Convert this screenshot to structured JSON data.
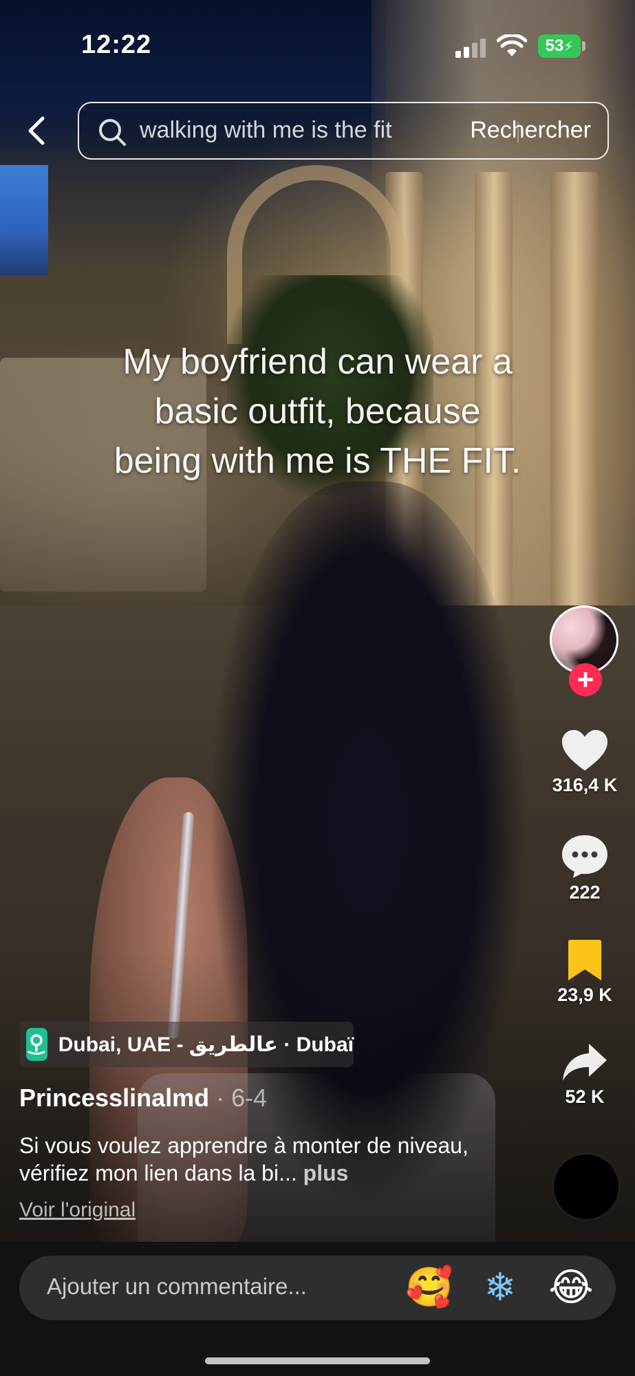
{
  "status_bar": {
    "time": "12:22",
    "battery": "53",
    "battery_color": "#35c759"
  },
  "search": {
    "query": "walking with me is the fit",
    "submit_label": "Rechercher",
    "icon": "search-icon"
  },
  "video": {
    "caption": "My boyfriend can wear a\nbasic outfit, because\nbeing with me is THE FIT."
  },
  "actions": {
    "follow_label": "+",
    "like_count": "316,4 K",
    "comment_count": "222",
    "save_count": "23,9 K",
    "share_count": "52 K",
    "save_color": "#fcc419",
    "follow_color": "#fe2c55"
  },
  "post": {
    "location": "Dubai, UAE - عالطريق · Dubaï",
    "creator": "Princesslinalmd",
    "date_separator": " · ",
    "date": "6-4",
    "description": "Si vous voulez apprendre à monter de niveau, vérifiez mon lien dans la bi... ",
    "more_label": "plus",
    "view_original_label": "Voir l'original"
  },
  "comment_bar": {
    "placeholder": "Ajouter un commentaire...",
    "emojis": [
      "🥰",
      "❄",
      "😂"
    ]
  }
}
